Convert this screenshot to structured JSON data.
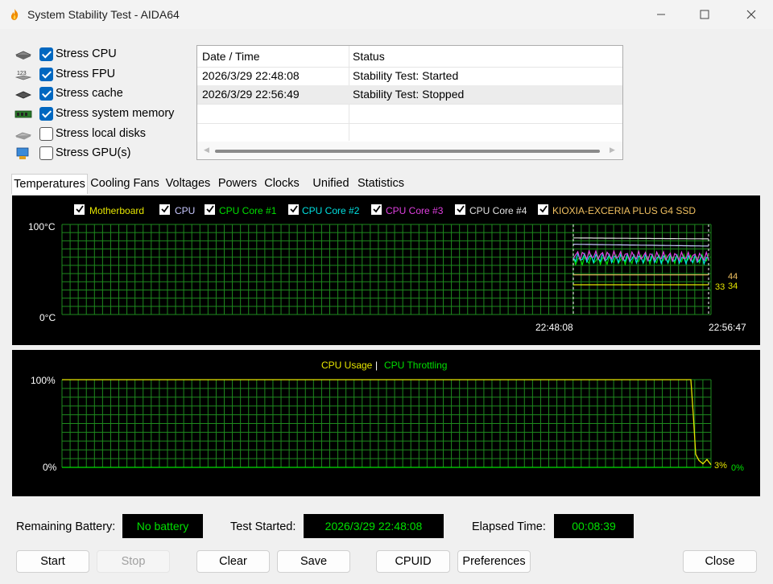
{
  "window": {
    "title": "System Stability Test - AIDA64"
  },
  "stress_options": [
    {
      "label": "Stress CPU",
      "checked": true,
      "icon": "cpu-chip-icon"
    },
    {
      "label": "Stress FPU",
      "checked": true,
      "icon": "fpu-123-icon"
    },
    {
      "label": "Stress cache",
      "checked": true,
      "icon": "cache-chip-icon"
    },
    {
      "label": "Stress system memory",
      "checked": true,
      "icon": "memory-module-icon"
    },
    {
      "label": "Stress local disks",
      "checked": false,
      "icon": "disk-drive-icon"
    },
    {
      "label": "Stress GPU(s)",
      "checked": false,
      "icon": "gpu-monitor-icon"
    }
  ],
  "log": {
    "headers": [
      "Date / Time",
      "Status"
    ],
    "rows": [
      {
        "time": "2026/3/29 22:48:08",
        "status": "Stability Test: Started"
      },
      {
        "time": "2026/3/29 22:56:49",
        "status": "Stability Test: Stopped"
      }
    ]
  },
  "tabs": [
    "Temperatures",
    "Cooling Fans",
    "Voltages",
    "Powers",
    "Clocks",
    "Unified",
    "Statistics"
  ],
  "active_tab": "Temperatures",
  "temp_graph": {
    "legend": [
      {
        "label": "Motherboard",
        "color": "#e6e600"
      },
      {
        "label": "CPU",
        "color": "#c8c8ff"
      },
      {
        "label": "CPU Core #1",
        "color": "#00e000"
      },
      {
        "label": "CPU Core #2",
        "color": "#00e0e0"
      },
      {
        "label": "CPU Core #3",
        "color": "#e040e0"
      },
      {
        "label": "CPU Core #4",
        "color": "#e0e0e0"
      },
      {
        "label": "KIOXIA-EXCERIA PLUS G4 SSD",
        "color": "#f0c060"
      }
    ],
    "y_top": "100°C",
    "y_bottom": "0°C",
    "x_start": "22:48:08",
    "x_end": "22:56:47",
    "value_labels": [
      "33",
      "34",
      "44"
    ]
  },
  "cpu_graph": {
    "legend_usage": "CPU Usage",
    "legend_sep": "|",
    "legend_throttling": "CPU Throttling",
    "y_top": "100%",
    "y_bottom": "0%",
    "usage_value": "3%",
    "throttling_value": "0%",
    "usage_color": "#e6e600",
    "throttling_color": "#00e000"
  },
  "status": {
    "battery_label": "Remaining Battery:",
    "battery_value": "No battery",
    "started_label": "Test Started:",
    "started_value": "2026/3/29 22:48:08",
    "elapsed_label": "Elapsed Time:",
    "elapsed_value": "00:08:39"
  },
  "buttons": {
    "start": "Start",
    "stop": "Stop",
    "clear": "Clear",
    "save": "Save",
    "cpuid": "CPUID",
    "preferences": "Preferences",
    "close": "Close"
  },
  "chart_data": [
    {
      "type": "line",
      "x_range": [
        "22:48:08",
        "22:56:47"
      ],
      "ylim": [
        0,
        100
      ],
      "series": [
        {
          "name": "Motherboard",
          "values": [
            33,
            33
          ]
        },
        {
          "name": "CPU",
          "values": [
            78,
            76
          ]
        },
        {
          "name": "CPU Core #1",
          "values": [
            60,
            62
          ]
        },
        {
          "name": "CPU Core #2",
          "values": [
            63,
            61
          ]
        },
        {
          "name": "CPU Core #3",
          "values": [
            66,
            64
          ]
        },
        {
          "name": "CPU Core #4",
          "values": [
            85,
            84
          ]
        },
        {
          "name": "KIOXIA-EXCERIA PLUS G4 SSD",
          "values": [
            44,
            44
          ]
        }
      ]
    },
    {
      "type": "line",
      "ylim": [
        0,
        100
      ],
      "series": [
        {
          "name": "CPU Usage",
          "values": [
            100,
            100,
            3
          ]
        },
        {
          "name": "CPU Throttling",
          "values": [
            0,
            0,
            0
          ]
        }
      ]
    }
  ]
}
